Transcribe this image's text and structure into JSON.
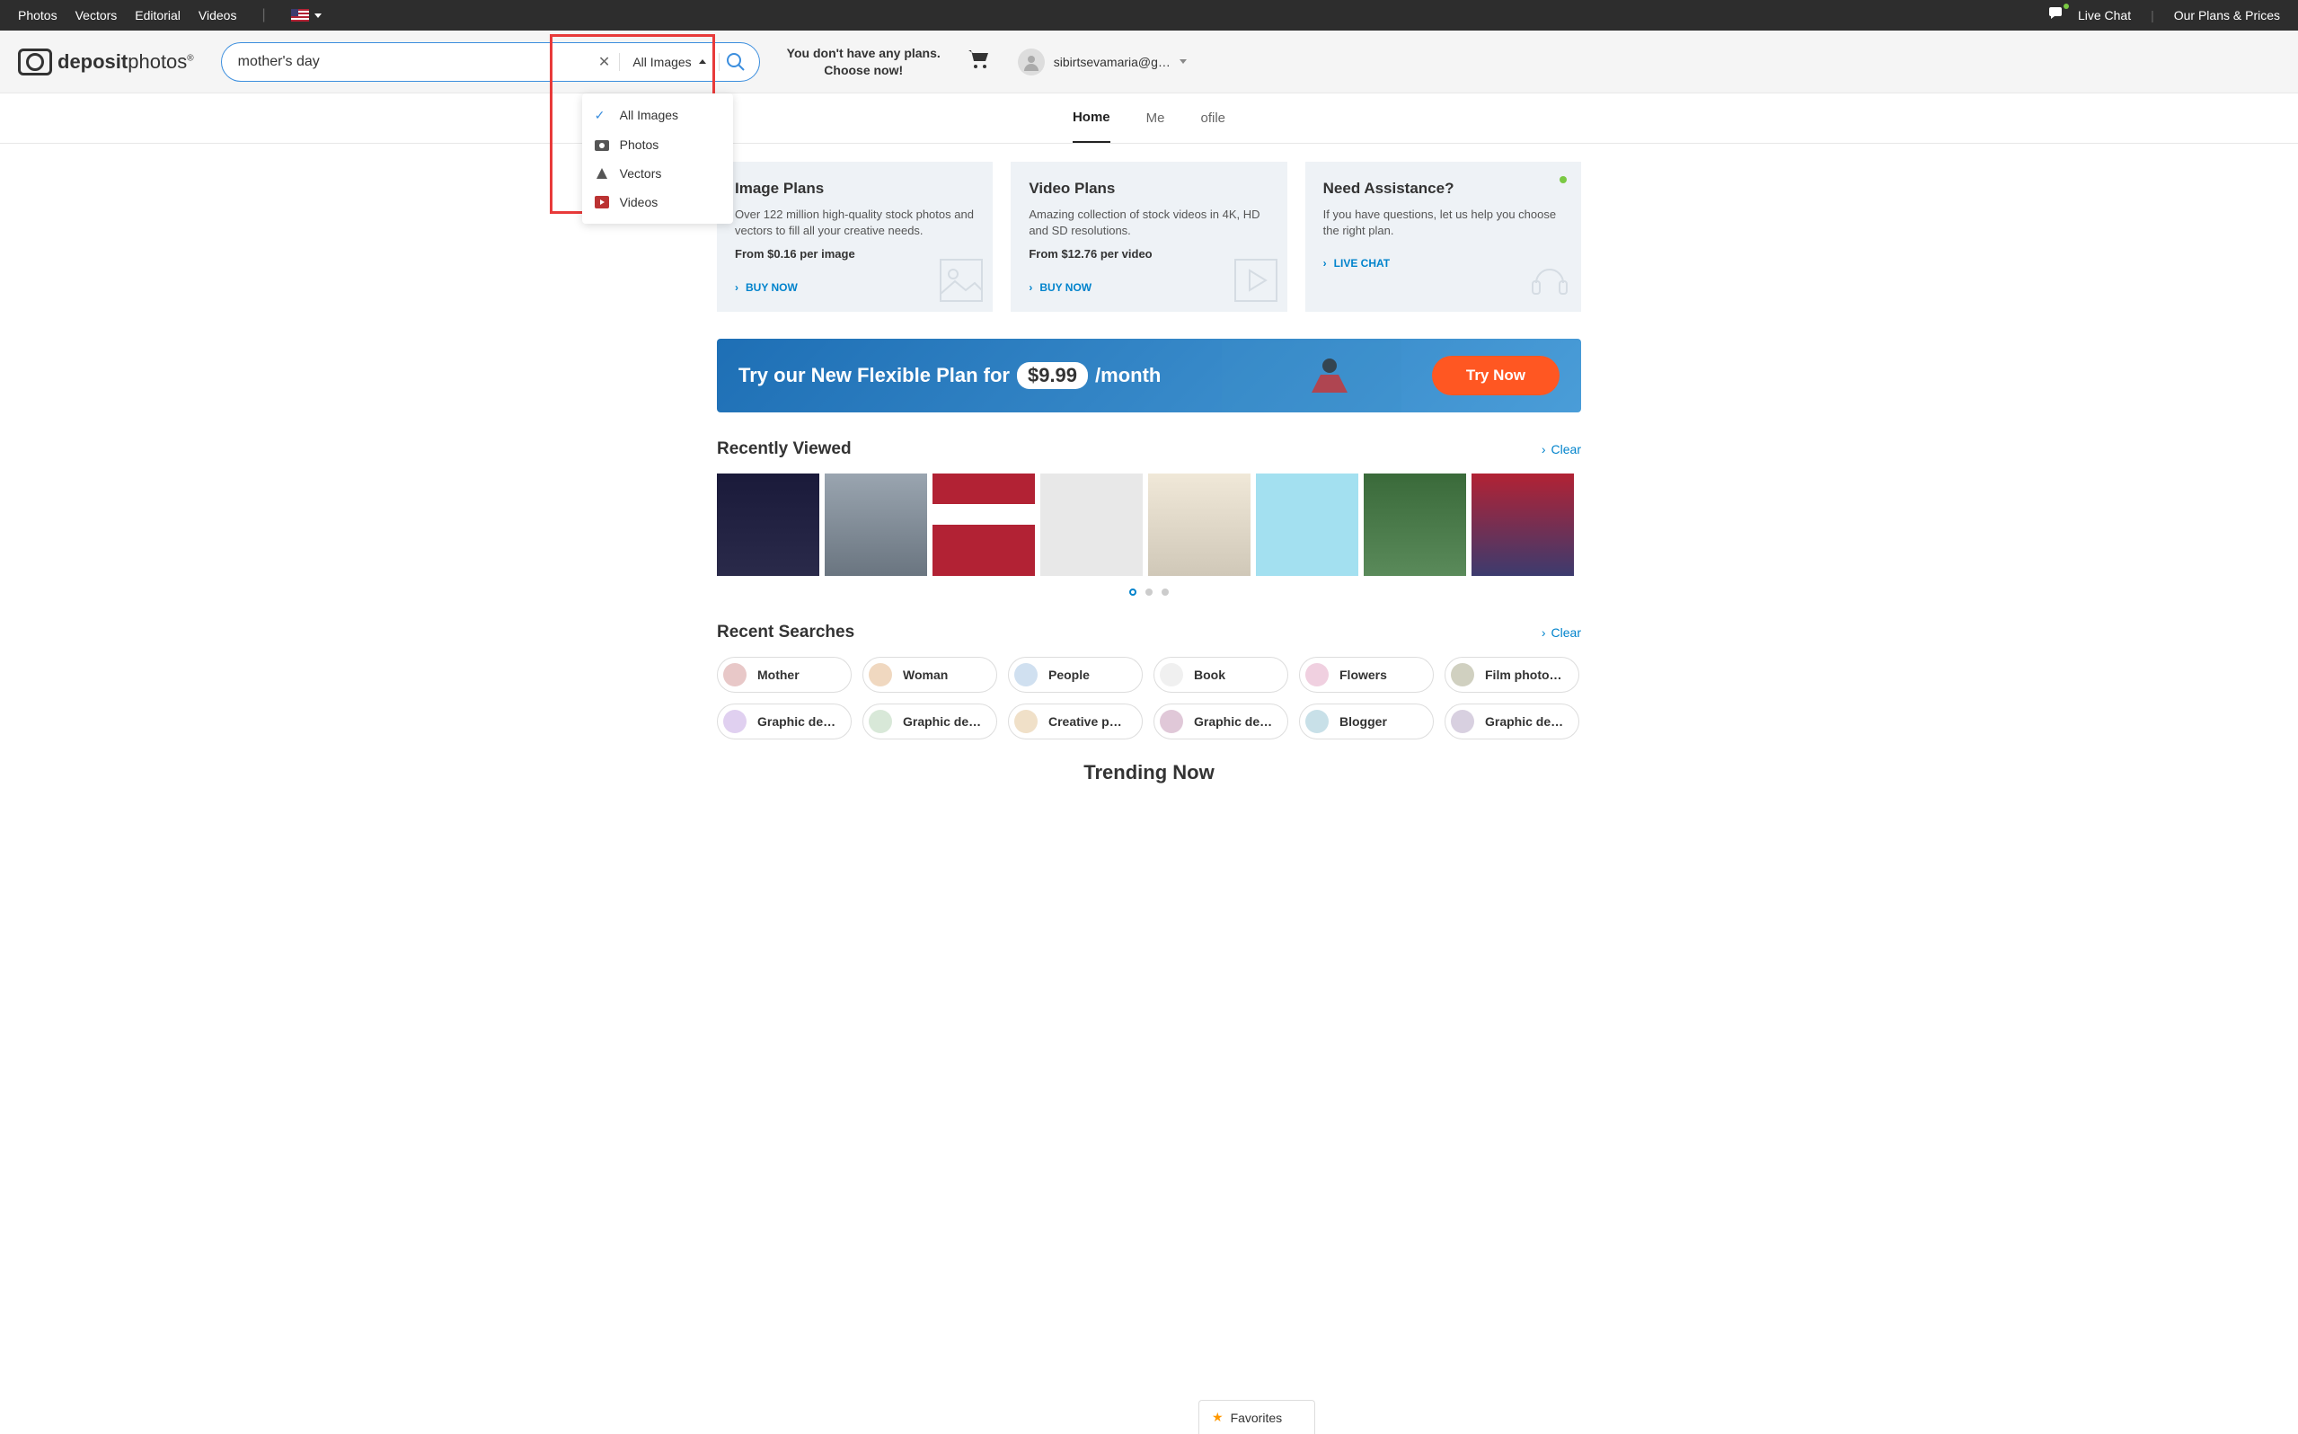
{
  "topbar": {
    "links": [
      "Photos",
      "Vectors",
      "Editorial",
      "Videos"
    ],
    "live_chat": "Live Chat",
    "plans": "Our Plans & Prices"
  },
  "logo": {
    "brand": "depositphotos"
  },
  "search": {
    "value": "mother's day",
    "type_label": "All Images",
    "dropdown": [
      {
        "icon": "check",
        "label": "All Images"
      },
      {
        "icon": "camera",
        "label": "Photos"
      },
      {
        "icon": "vector",
        "label": "Vectors"
      },
      {
        "icon": "video",
        "label": "Videos"
      }
    ]
  },
  "header": {
    "msg_line1": "You don't have any plans.",
    "msg_line2": "Choose now!",
    "username": "sibirtsevamaria@g…"
  },
  "subnav": {
    "home": "Home",
    "menu": "Me",
    "profile": "ofile"
  },
  "cards": [
    {
      "title": "Image Plans",
      "desc": "Over 122 million high-quality stock photos and vectors to fill all your creative needs.",
      "price": "From $0.16 per image",
      "action": "BUY NOW"
    },
    {
      "title": "Video Plans",
      "desc": "Amazing collection of stock videos in 4K, HD and SD resolutions.",
      "price": "From $12.76 per video",
      "action": "BUY NOW"
    },
    {
      "title": "Need Assistance?",
      "desc": "If you have questions, let us help you choose the right plan.",
      "price": "",
      "action": "LIVE CHAT"
    }
  ],
  "banner": {
    "text_pre": "Try our New Flexible Plan for",
    "price": "$9.99",
    "text_post": "/month",
    "btn": "Try Now"
  },
  "recently_viewed": {
    "title": "Recently Viewed",
    "clear": "Clear"
  },
  "recent_searches": {
    "title": "Recent Searches",
    "clear": "Clear",
    "chips": [
      "Mother",
      "Woman",
      "People",
      "Book",
      "Flowers",
      "Film photogr…",
      "Graphic design",
      "Graphic desi…",
      "Creative person",
      "Graphic desi…",
      "Blogger",
      "Graphic desi…"
    ]
  },
  "trending": "Trending Now",
  "favorites": "Favorites"
}
